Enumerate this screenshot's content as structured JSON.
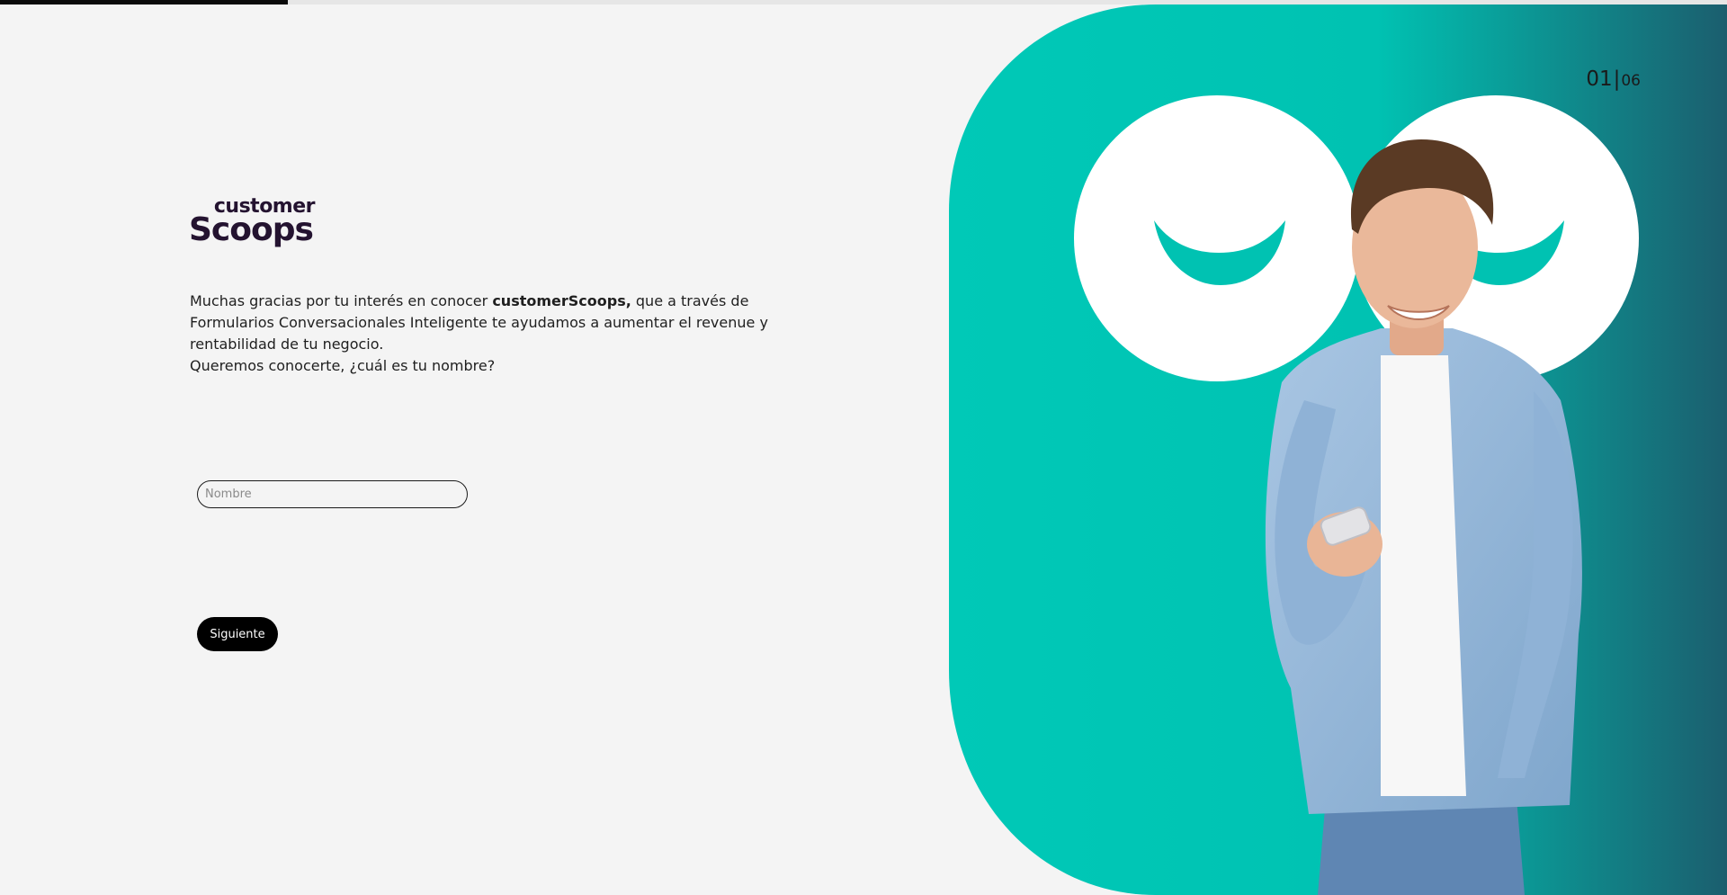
{
  "progress": {
    "fraction": 0.1667
  },
  "brand": {
    "logo_top": "customer",
    "logo_bottom": "Scoops",
    "accent_color": "#00c9b7",
    "dark_color": "#241330"
  },
  "intro": {
    "lead": "Muchas gracias por tu interés en conocer ",
    "brand_bold": "customerScoops,",
    "rest": " que a través de Formularios Conversacionales Inteligente te ayudamos a aumentar el revenue y rentabilidad de tu negocio.",
    "question": "Queremos conocerte, ¿cuál es tu nombre?"
  },
  "form": {
    "name_placeholder": "Nombre",
    "name_value": "",
    "next_label": "Siguiente"
  },
  "step": {
    "current": "01",
    "separator": "|",
    "total": "06"
  },
  "hero": {
    "icon": "person-with-phone-illustration"
  }
}
